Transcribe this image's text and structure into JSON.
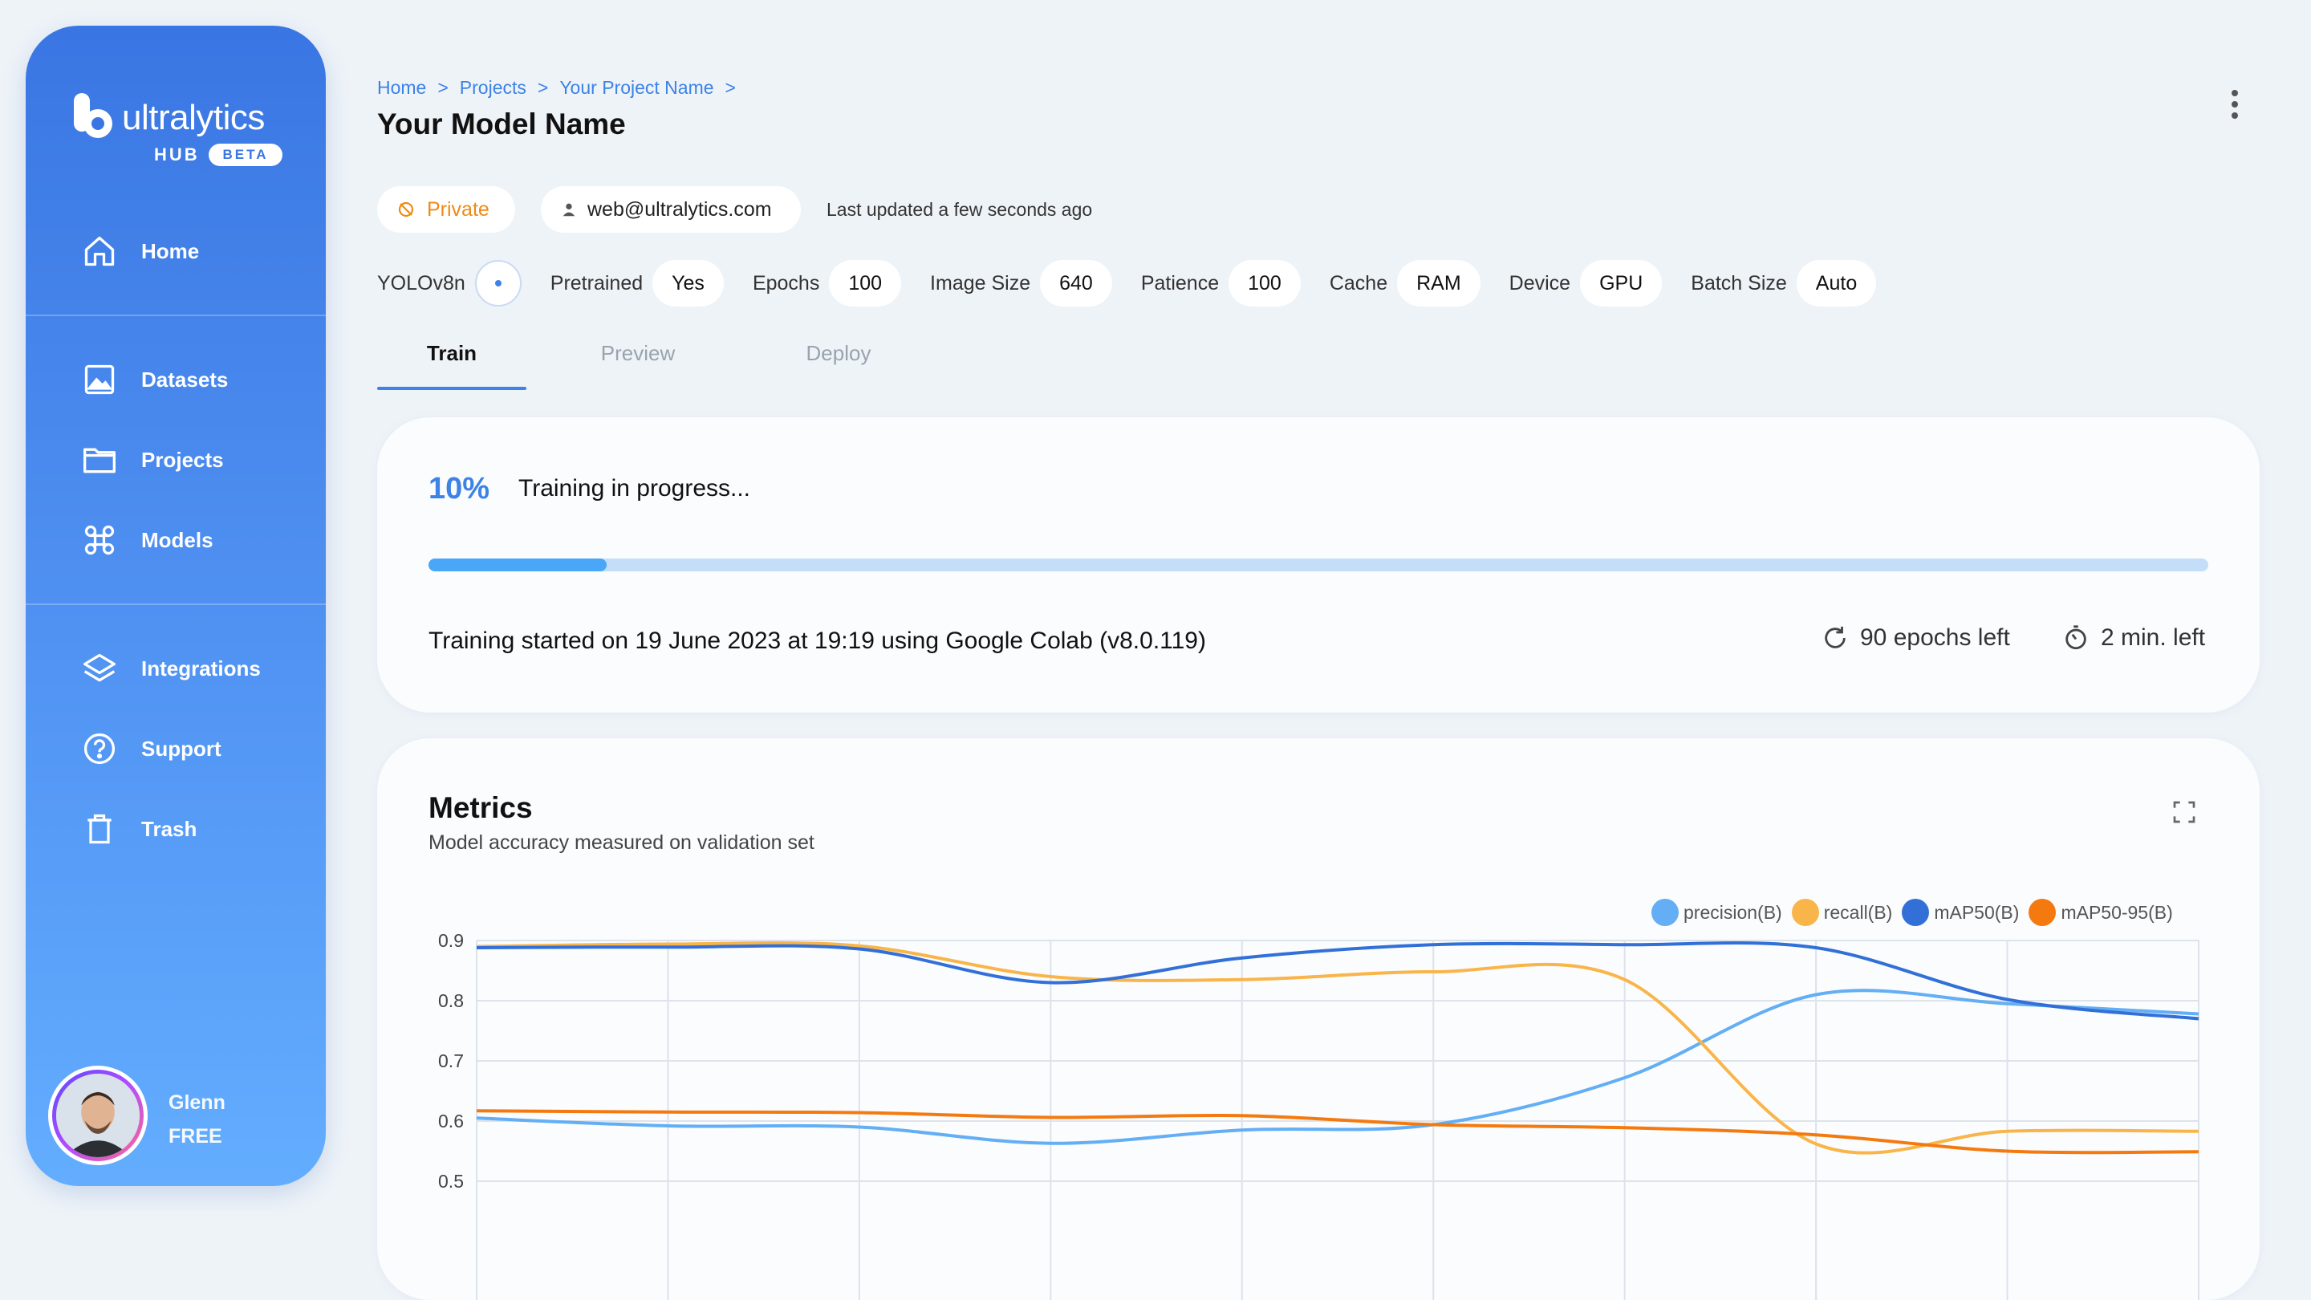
{
  "sidebar": {
    "logo": {
      "word": "ultralytics",
      "hub": "HUB",
      "beta": "BETA"
    },
    "items": [
      {
        "label": "Home",
        "icon": "home-icon"
      },
      {
        "label": "Datasets",
        "icon": "image-icon"
      },
      {
        "label": "Projects",
        "icon": "folder-icon"
      },
      {
        "label": "Models",
        "icon": "command-icon"
      },
      {
        "label": "Integrations",
        "icon": "layers-icon"
      },
      {
        "label": "Support",
        "icon": "help-circle-icon"
      },
      {
        "label": "Trash",
        "icon": "trash-icon"
      }
    ],
    "user": {
      "name": "Glenn",
      "plan": "FREE"
    }
  },
  "breadcrumb": [
    "Home",
    "Projects",
    "Your Project Name"
  ],
  "page_title": "Your Model Name",
  "visibility": "Private",
  "email": "web@ultralytics.com",
  "last_updated": "Last updated a few seconds ago",
  "params": {
    "model": "YOLOv8n",
    "pretrained_label": "Pretrained",
    "pretrained": "Yes",
    "epochs_label": "Epochs",
    "epochs": "100",
    "image_size_label": "Image Size",
    "image_size": "640",
    "patience_label": "Patience",
    "patience": "100",
    "cache_label": "Cache",
    "cache": "RAM",
    "device_label": "Device",
    "device": "GPU",
    "batch_label": "Batch Size",
    "batch": "Auto"
  },
  "tabs": [
    "Train",
    "Preview",
    "Deploy"
  ],
  "active_tab": "Train",
  "progress": {
    "percent_label": "10%",
    "percent": 0.1,
    "status": "Training in progress...",
    "started": "Training started on 19 June 2023 at 19:19 using Google Colab (v8.0.119)",
    "epochs_left": "90 epochs left",
    "time_left": "2 min. left"
  },
  "metrics": {
    "title": "Metrics",
    "subtitle": "Model accuracy measured on validation set"
  },
  "colors": {
    "accent": "#3d82e6",
    "private": "#f08a14"
  },
  "chart_data": {
    "type": "line",
    "x": [
      0,
      1,
      2,
      3,
      4,
      5,
      6,
      7,
      8,
      9
    ],
    "ylim": [
      0.5,
      0.9
    ],
    "yticks": [
      "0.9",
      "0.8",
      "0.7",
      "0.6",
      "0.5"
    ],
    "grid": true,
    "legend": "top-right",
    "series": [
      {
        "name": "precision(B)",
        "color": "#63aef5",
        "values": [
          0.605,
          0.592,
          0.59,
          0.563,
          0.585,
          0.594,
          0.672,
          0.81,
          0.795,
          0.778
        ]
      },
      {
        "name": "recall(B)",
        "color": "#f9b54a",
        "values": [
          0.89,
          0.894,
          0.891,
          0.84,
          0.835,
          0.848,
          0.835,
          0.562,
          0.583,
          0.583
        ]
      },
      {
        "name": "mAP50(B)",
        "color": "#3270d8",
        "values": [
          0.888,
          0.889,
          0.886,
          0.83,
          0.871,
          0.893,
          0.893,
          0.888,
          0.802,
          0.77
        ]
      },
      {
        "name": "mAP50-95(B)",
        "color": "#f47a10",
        "values": [
          0.617,
          0.615,
          0.614,
          0.606,
          0.609,
          0.594,
          0.589,
          0.577,
          0.55,
          0.549
        ]
      }
    ]
  }
}
